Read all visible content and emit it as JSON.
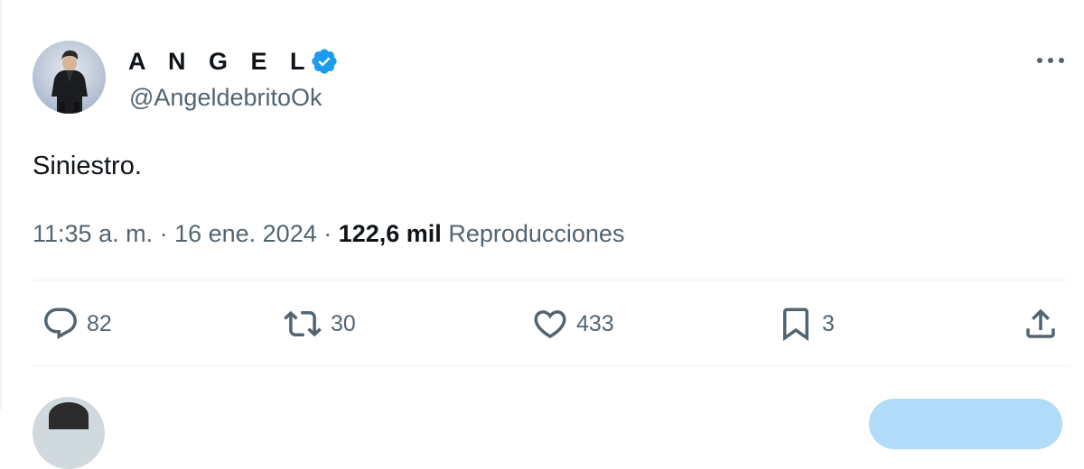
{
  "author": {
    "display_name": "A N G E L",
    "handle": "@AngeldebritoOk",
    "verified_color": "#1d9bf0"
  },
  "tweet": {
    "text": "Siniestro.",
    "time": "11:35 a. m.",
    "date": "16 ene. 2024",
    "views_count": "122,6 mil",
    "views_label": "Reproducciones"
  },
  "actions": {
    "reply": {
      "icon": "reply-icon",
      "count": "82"
    },
    "retweet": {
      "icon": "retweet-icon",
      "count": "30"
    },
    "like": {
      "icon": "like-icon",
      "count": "433"
    },
    "bookmark": {
      "icon": "bookmark-icon",
      "count": "3"
    },
    "share": {
      "icon": "share-icon"
    }
  },
  "colors": {
    "text_primary": "#0f1419",
    "text_secondary": "#536471",
    "divider": "#eff3f4",
    "accent": "#1d9bf0"
  }
}
